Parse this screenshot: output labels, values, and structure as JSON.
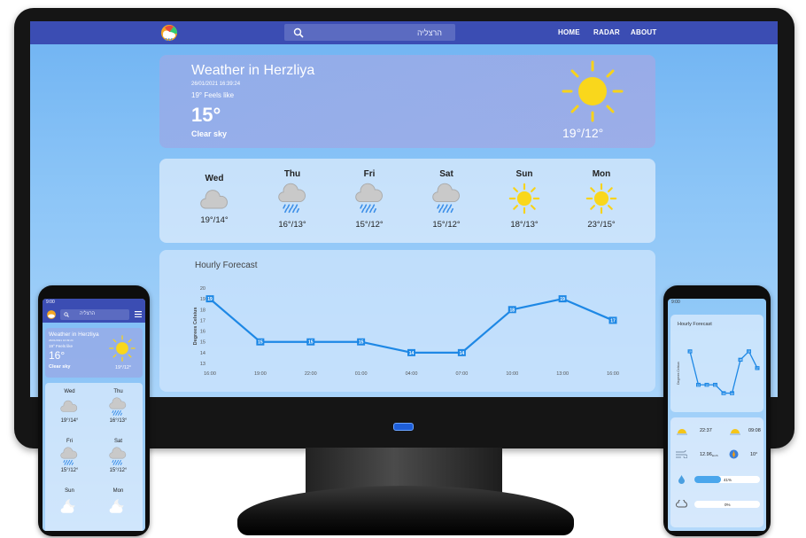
{
  "app": {
    "nav": {
      "search_value": "הרצליה",
      "links": [
        "HOME",
        "RADAR",
        "ABOUT"
      ]
    },
    "current": {
      "city_title": "Weather in Herzliya",
      "datetime": "26/01/2021 16:39:24",
      "feels_like": "19° Feels like",
      "temperature": "15°",
      "condition": "Clear sky",
      "range": "19°/12°",
      "icon": "sun-icon"
    },
    "daily": [
      {
        "day": "Wed",
        "range": "19°/14°",
        "icon": "cloud-icon"
      },
      {
        "day": "Thu",
        "range": "16°/13°",
        "icon": "rain-cloud-icon"
      },
      {
        "day": "Fri",
        "range": "15°/12°",
        "icon": "rain-cloud-icon"
      },
      {
        "day": "Sat",
        "range": "15°/12°",
        "icon": "rain-cloud-icon"
      },
      {
        "day": "Sun",
        "range": "18°/13°",
        "icon": "sun-icon"
      },
      {
        "day": "Mon",
        "range": "23°/15°",
        "icon": "sun-icon"
      }
    ]
  },
  "chart_data": {
    "type": "line",
    "title": "Hourly Forecast",
    "ylabel": "Degrees Celsius",
    "xlabel": "",
    "x": [
      "16:00",
      "19:00",
      "22:00",
      "01:00",
      "04:00",
      "07:00",
      "10:00",
      "13:00",
      "16:00"
    ],
    "yticks": [
      "13",
      "14",
      "15",
      "16",
      "17",
      "18",
      "19",
      "20"
    ],
    "ylim": [
      13,
      20
    ],
    "series": [
      {
        "values": [
          19,
          15,
          15,
          15,
          14,
          14,
          18,
          19,
          17
        ]
      }
    ],
    "grid": false,
    "line_color": "#1e88e5"
  },
  "phone_left": {
    "time": "9:00",
    "search_value": "הרצליה",
    "current": {
      "city_title": "Weather in Herzliya",
      "datetime": "26/01/2021 16:39:24",
      "feels_like": "19° Feels like",
      "temperature": "16°",
      "condition": "Clear sky",
      "range": "19°/12°"
    },
    "daily": [
      {
        "day": "Wed",
        "range": "19°/14°",
        "icon": "cloud-icon"
      },
      {
        "day": "Thu",
        "range": "16°/13°",
        "icon": "rain-cloud-icon"
      },
      {
        "day": "Fri",
        "range": "15°/12°",
        "icon": "rain-cloud-icon"
      },
      {
        "day": "Sat",
        "range": "15°/12°",
        "icon": "rain-cloud-icon"
      },
      {
        "day": "Sun",
        "range": "",
        "icon": "moon-cloud-icon"
      },
      {
        "day": "Mon",
        "range": "",
        "icon": "moon-cloud-icon"
      }
    ]
  },
  "phone_right": {
    "time": "9:00",
    "chart_title": "Hourly Forecast",
    "ylabel": "Degrees Celsius",
    "series_values": [
      19,
      15,
      15,
      15,
      14,
      14,
      18,
      19,
      17
    ],
    "sunrise": "22:37",
    "sunset": "09:08",
    "wind_speed": "12.96",
    "wind_unit": "km/h",
    "wind_direction": "10°",
    "humidity": "41%",
    "humidity_level": 0.41,
    "clouds": "0%",
    "clouds_level": 0.0
  }
}
